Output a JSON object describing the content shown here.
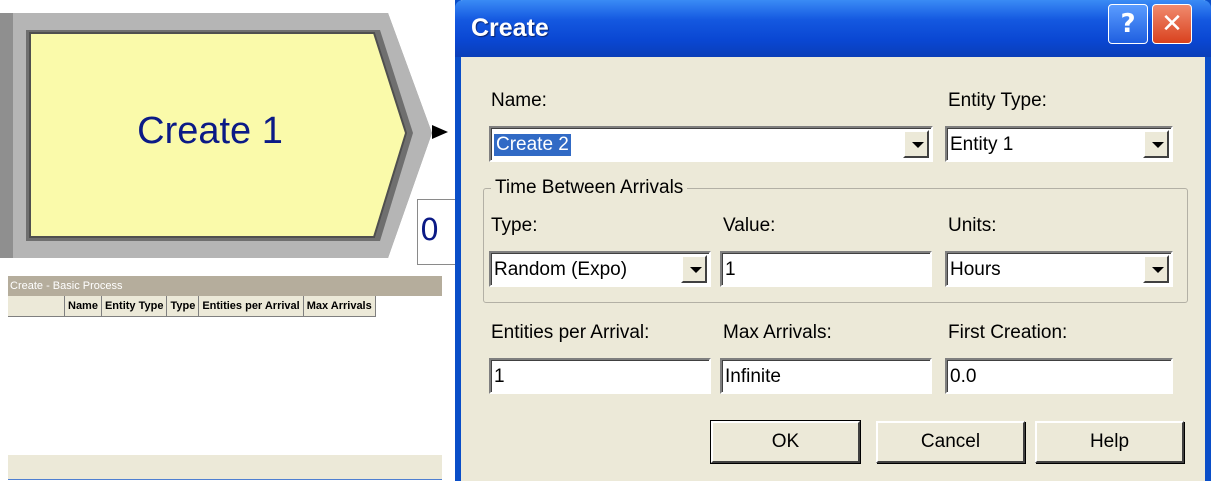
{
  "module": {
    "label": "Create 1",
    "counter": "0"
  },
  "spreadsheet": {
    "title": "Create - Basic Process",
    "columns": [
      "Name",
      "Entity Type",
      "Type",
      "Entities per Arrival",
      "Max Arrivals"
    ]
  },
  "dialog": {
    "title": "Create",
    "help_glyph": "?",
    "close_glyph": "✕",
    "name_label": "Name:",
    "name_value": "Create 2",
    "entity_type_label": "Entity Type:",
    "entity_type_value": "Entity 1",
    "group_title": "Time Between Arrivals",
    "type_label": "Type:",
    "type_value": "Random (Expo)",
    "value_label": "Value:",
    "value_value": "1",
    "units_label": "Units:",
    "units_value": "Hours",
    "entities_per_arrival_label": "Entities per Arrival:",
    "entities_per_arrival_value": "1",
    "max_arrivals_label": "Max Arrivals:",
    "max_arrivals_value": "Infinite",
    "first_creation_label": "First Creation:",
    "first_creation_value": "0.0",
    "ok_label": "OK",
    "cancel_label": "Cancel",
    "help_label": "Help"
  },
  "colors": {
    "module_fill": "#fafaaa",
    "title_bar": "#0a47d3",
    "dialog_bg": "#ece9d8"
  }
}
